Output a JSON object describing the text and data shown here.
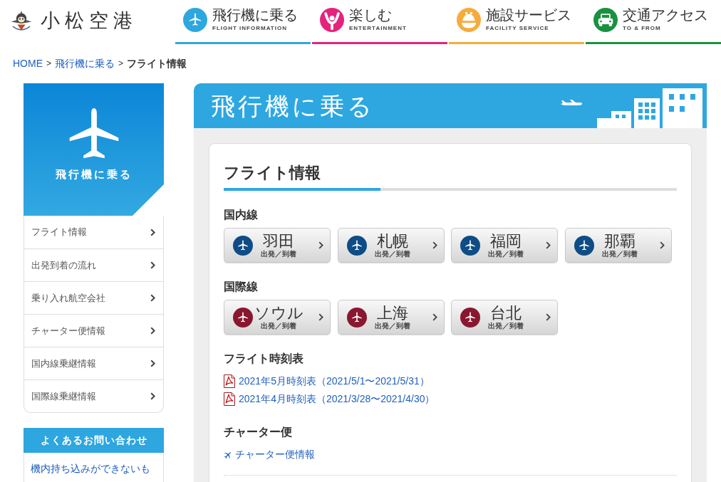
{
  "header": {
    "site_title": "小松空港",
    "nav": [
      {
        "label": "飛行機に乗る",
        "sublabel": "FLIGHT INFORMATION",
        "color": "#2ea7e0"
      },
      {
        "label": "楽しむ",
        "sublabel": "ENTERTAINMENT",
        "color": "#e4237d"
      },
      {
        "label": "施設サービス",
        "sublabel": "FACILITY SERVICE",
        "color": "#f6ac3a"
      },
      {
        "label": "交通アクセス",
        "sublabel": "TO & FROM",
        "color": "#1a9140"
      }
    ]
  },
  "breadcrumb": {
    "items": [
      {
        "label": "HOME",
        "current": false,
        "separator": ">"
      },
      {
        "label": "飛行機に乗る",
        "current": false,
        "separator": ">"
      },
      {
        "label": "フライト情報",
        "current": true
      }
    ]
  },
  "sidebar": {
    "title": "飛行機に乗る",
    "items": [
      "フライト情報",
      "出発到着の流れ",
      "乗り入れ航空会社",
      "チャーター便情報",
      "国内線乗継情報",
      "国際線乗継情報"
    ],
    "faq": {
      "title": "よくあるお問い合わせ",
      "links": [
        "機内持ち込みができないも"
      ]
    }
  },
  "main": {
    "banner_title": "飛行機に乗る",
    "heading": "フライト情報",
    "sections": [
      {
        "kind": "destinations",
        "title": "国内線",
        "color": "#0e4c85",
        "buttons": [
          {
            "city": "羽田",
            "sub": "出発／到着"
          },
          {
            "city": "札幌",
            "sub": "出発／到着"
          },
          {
            "city": "福岡",
            "sub": "出発／到着"
          },
          {
            "city": "那覇",
            "sub": "出発／到着"
          }
        ]
      },
      {
        "kind": "destinations",
        "title": "国際線",
        "color": "#8a1730",
        "buttons": [
          {
            "city": "ソウル",
            "sub": "出発／到着"
          },
          {
            "city": "上海",
            "sub": "出発／到着"
          },
          {
            "city": "台北",
            "sub": "出発／到着"
          }
        ]
      },
      {
        "kind": "documents",
        "title": "フライト時刻表",
        "links": [
          "2021年5月時刻表（2021/5/1〜2021/5/31）",
          "2021年4月時刻表（2021/3/28〜2021/4/30）"
        ]
      },
      {
        "kind": "links",
        "title": "チャーター便",
        "links": [
          "チャーター便情報"
        ]
      }
    ]
  }
}
